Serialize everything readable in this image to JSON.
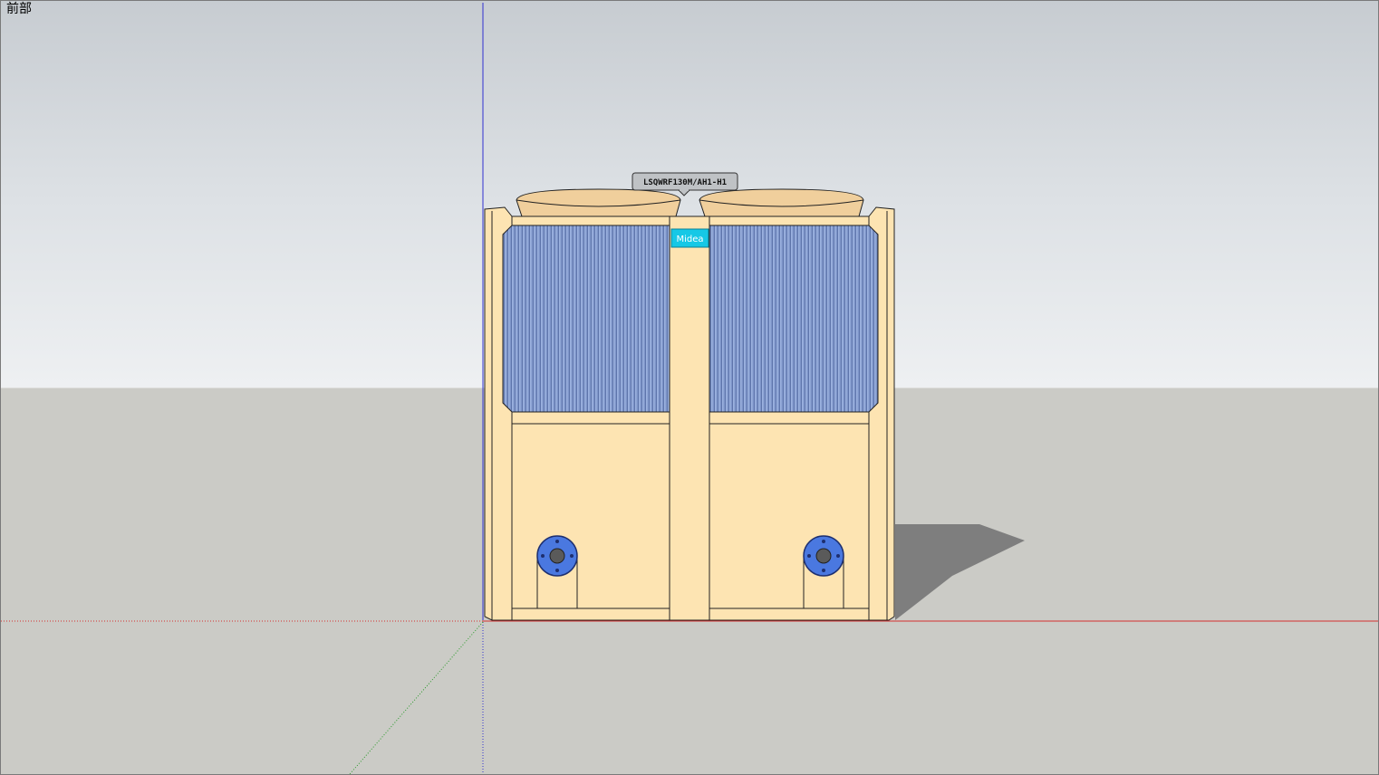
{
  "viewport": {
    "scene_name": "前部",
    "colors": {
      "sky_top": "#c7ccd1",
      "sky_horizon": "#eef0f2",
      "ground": "#cbcbc6",
      "red_axis": "#d43030",
      "green_axis": "#2a9a2a",
      "blue_axis": "#3030d0"
    }
  },
  "model": {
    "tag_label": "LSQWRF130M/AH1-H1",
    "brand_logo": "Midea",
    "colors": {
      "body": "#fde4b2",
      "coil": "#7b93c8",
      "logo_bg": "#16c8e6",
      "flange": "#4a78e0",
      "shadow": "#7e7e7e"
    }
  }
}
